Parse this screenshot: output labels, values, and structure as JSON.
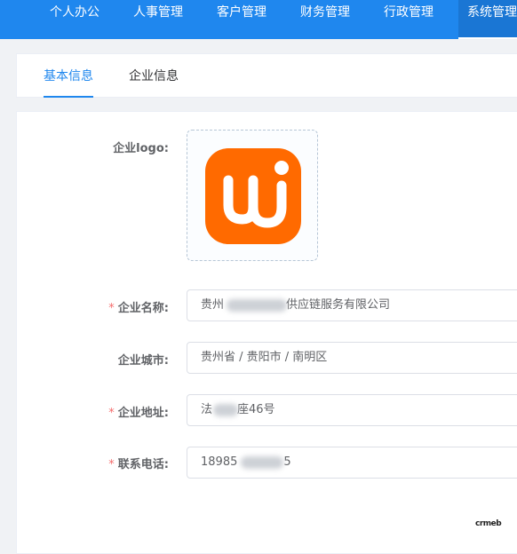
{
  "top_nav": {
    "items": [
      {
        "label": "个人办公"
      },
      {
        "label": "人事管理"
      },
      {
        "label": "客户管理"
      },
      {
        "label": "财务管理"
      },
      {
        "label": "行政管理"
      },
      {
        "label": "系统管理",
        "active": true
      }
    ],
    "color": "#1f87ee"
  },
  "tabs": [
    {
      "label": "基本信息",
      "active": true
    },
    {
      "label": "企业信息",
      "active": false
    }
  ],
  "form": {
    "logo_label": "企业logo:",
    "name_label": "企业名称:",
    "name_value": "贵州",
    "name_value_tail": "供应链服务有限公司",
    "city_label": "企业城市:",
    "city_value": "贵州省 / 贵阳市 / 南明区",
    "address_label": "企业地址:",
    "address_value": "法",
    "address_value_tail": "座46号",
    "phone_label": "联系电话:",
    "phone_value": "18985",
    "phone_value_tail": "5",
    "required_mark": "*"
  },
  "logo": {
    "icon": "crmeb-logo-icon",
    "brand_color": "#ff6a00"
  },
  "watermark": "crmeb"
}
